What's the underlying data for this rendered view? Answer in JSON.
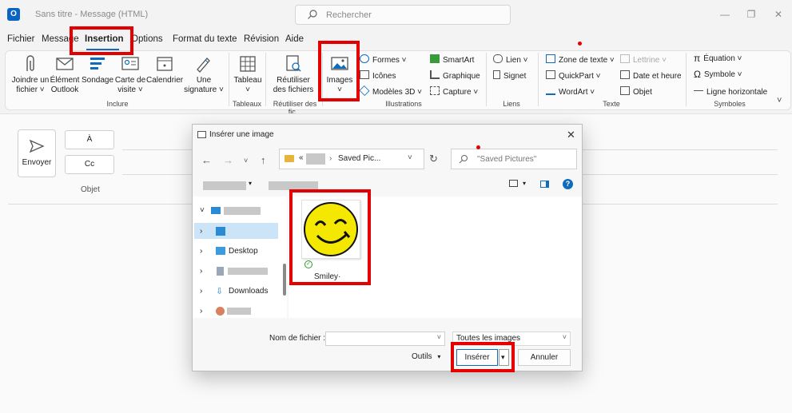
{
  "titlebar": {
    "app_icon": "outlook-logo",
    "title": "Sans titre  -  Message (HTML)",
    "search_placeholder": "Rechercher",
    "window_buttons": [
      "minimize-icon",
      "restore-icon",
      "close-icon"
    ]
  },
  "tabs": [
    "Fichier",
    "Message",
    "Insertion",
    "Options",
    "Format du texte",
    "Révision",
    "Aide"
  ],
  "active_tab": "Insertion",
  "ribbon": {
    "include": {
      "attach": [
        "Joindre un",
        "fichier ˅"
      ],
      "outlook_item": [
        "Élément",
        "Outlook"
      ],
      "poll": "Sondage",
      "card": [
        "Carte de",
        "visite ˅"
      ],
      "calendar": "Calendrier",
      "signature": [
        "Une",
        "signature ˅"
      ],
      "group_label": "Inclure"
    },
    "tables": {
      "table": [
        "Tableau",
        "˅"
      ],
      "group_label": "Tableaux"
    },
    "reuse": {
      "reuse": [
        "Réutiliser",
        "des fichiers"
      ],
      "group_label": "Réutiliser des fic..."
    },
    "illustrations": {
      "images": [
        "Images",
        "˅"
      ],
      "shapes": "Formes ˅",
      "icons": "Icônes",
      "models3d": "Modèles 3D ˅",
      "smartart": "SmartArt",
      "chart": "Graphique",
      "capture": "Capture ˅",
      "group_label": "Illustrations"
    },
    "links": {
      "link": "Lien ˅",
      "bookmark": "Signet",
      "group_label": "Liens"
    },
    "text": {
      "textbox": "Zone de texte ˅",
      "quickpart": "QuickPart ˅",
      "wordart": "WordArt ˅",
      "dropcap": "Lettrine ˅",
      "datetime": "Date et heure",
      "object": "Objet",
      "group_label": "Texte"
    },
    "symbols": {
      "equation": "Équation  ˅",
      "symbol": "Symbole ˅",
      "hline": "Ligne horizontale",
      "group_label": "Symboles"
    },
    "collapse": "˅"
  },
  "compose": {
    "send": "Envoyer",
    "to": "À",
    "cc": "Cc",
    "subject": "Objet"
  },
  "dialog": {
    "title": "Insérer une image",
    "close": "✕",
    "address": {
      "prefix": "«",
      "folder": "Saved Pic...",
      "chevron": "˅"
    },
    "search_placeholder": "\"Saved Pictures\"",
    "nav_items": [
      {
        "label": "",
        "icon": "computer-icon",
        "expand": "˅"
      },
      {
        "label": "",
        "icon": "pictures-icon",
        "expand": "›"
      },
      {
        "label": "Desktop",
        "icon": "desktop-icon",
        "expand": "›"
      },
      {
        "label": "",
        "icon": "documents-icon",
        "expand": "›"
      },
      {
        "label": "Downloads",
        "icon": "downloads-icon",
        "expand": "›"
      },
      {
        "label": "",
        "icon": "music-icon",
        "expand": "›"
      }
    ],
    "file": {
      "name": "Smiley·",
      "status_icon": "synced-check-icon"
    },
    "filename_label": "Nom de fichier :",
    "filename_value": "",
    "filetype": "Toutes les images",
    "tools": "Outils",
    "insert": "Insérer",
    "cancel": "Annuler"
  },
  "colors": {
    "highlight": "#e40000",
    "accent": "#0f6cbd",
    "smiley": "#f5e800"
  }
}
